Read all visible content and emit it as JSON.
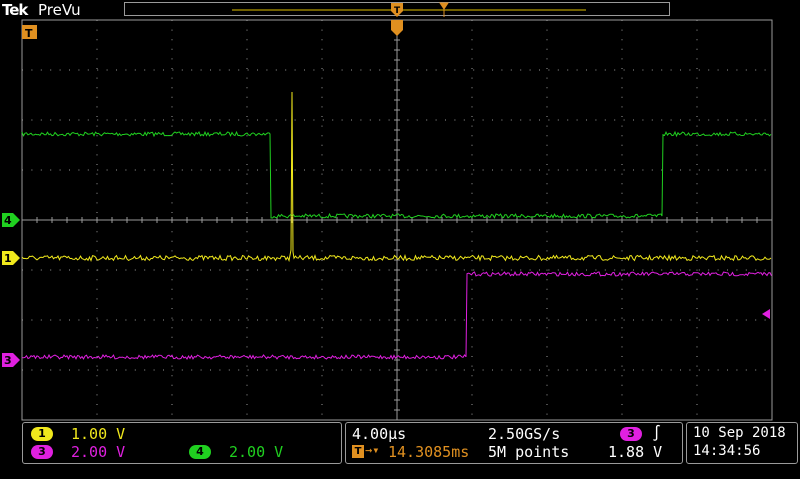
{
  "header": {
    "brand": "Tek",
    "mode": "PreVu"
  },
  "colors": {
    "ch1": "#f0e81c",
    "ch2": "#00c8c8",
    "ch3": "#e020e0",
    "ch4": "#20d020",
    "grid": "#8a8a8a",
    "trigger": "#e09020"
  },
  "markers": {
    "trigger_top": "T",
    "ch4": "4",
    "ch1": "1",
    "ch3": "3"
  },
  "channels": [
    {
      "num": "1",
      "scale": "1.00 V"
    },
    {
      "num": "3",
      "scale": "2.00 V"
    },
    {
      "num": "4",
      "scale": "2.00 V"
    }
  ],
  "timebase": {
    "per_div": "4.00µs",
    "sample_rate": "2.50GS/s",
    "trigger_position": "14.3085ms",
    "record": "5M points"
  },
  "trigger": {
    "source": "3",
    "slope_icon": "rising-edge-icon",
    "slope_glyph": "∫",
    "level": "1.88 V"
  },
  "datetime": {
    "date": "10 Sep  2018",
    "time": "14:34:56"
  }
}
